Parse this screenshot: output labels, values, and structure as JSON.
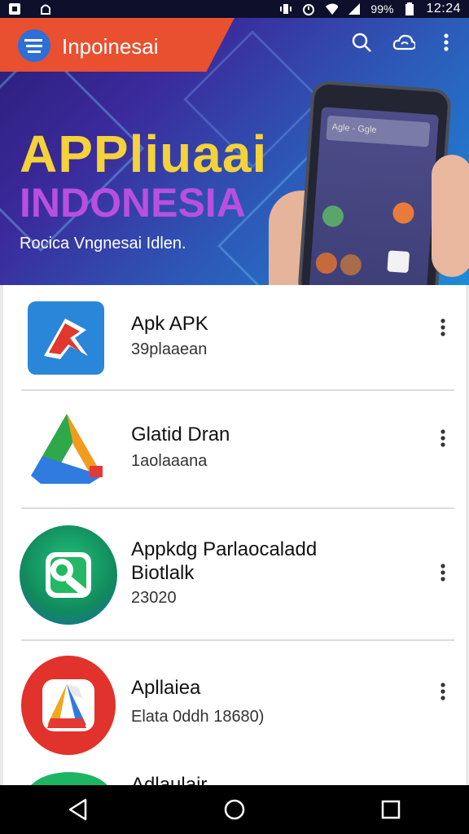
{
  "status_bar": {
    "battery_percent": "99%",
    "time": "12:24",
    "icons": [
      "app-notification-icon",
      "lock-notification-icon",
      "vibrate-icon",
      "alarm-icon",
      "wifi-icon",
      "signal-icon",
      "battery-icon"
    ]
  },
  "app_bar": {
    "title": "Inpoinesai",
    "icons": [
      "menu-logo-icon",
      "search-icon",
      "cloud-sync-icon",
      "more-vert-icon"
    ]
  },
  "banner": {
    "headline": "APPliuaai",
    "sub_headline": "INDONESIA",
    "tagline": "Rocica Vngnesai Idlen.",
    "phone_search_text": "Agle - Ggle",
    "colors": {
      "headline": "#f4d23a",
      "sub_headline": "#b84fe0",
      "brand_tab": "#e8502f"
    }
  },
  "apps": [
    {
      "name": "Apk APK",
      "subtitle": "39plaaean",
      "icon": "red-arrow-apk-icon"
    },
    {
      "name": "Glatid Dran",
      "subtitle": "1aolaaana",
      "icon": "drive-triangle-icon"
    },
    {
      "name": "Appkdg Parlaocaladd",
      "name_line2": "Biotlalk",
      "subtitle": "23020",
      "icon": "green-tool-circle-icon"
    },
    {
      "name": "Apllaiea",
      "subtitle": "Elata 0ddh 18680)",
      "icon": "red-circle-triangle-icon"
    },
    {
      "name": "Adlaulair",
      "subtitle": "",
      "icon": "green-circle-icon"
    }
  ],
  "nav_bar": {
    "icons": [
      "back-icon",
      "home-icon",
      "recents-icon"
    ]
  }
}
